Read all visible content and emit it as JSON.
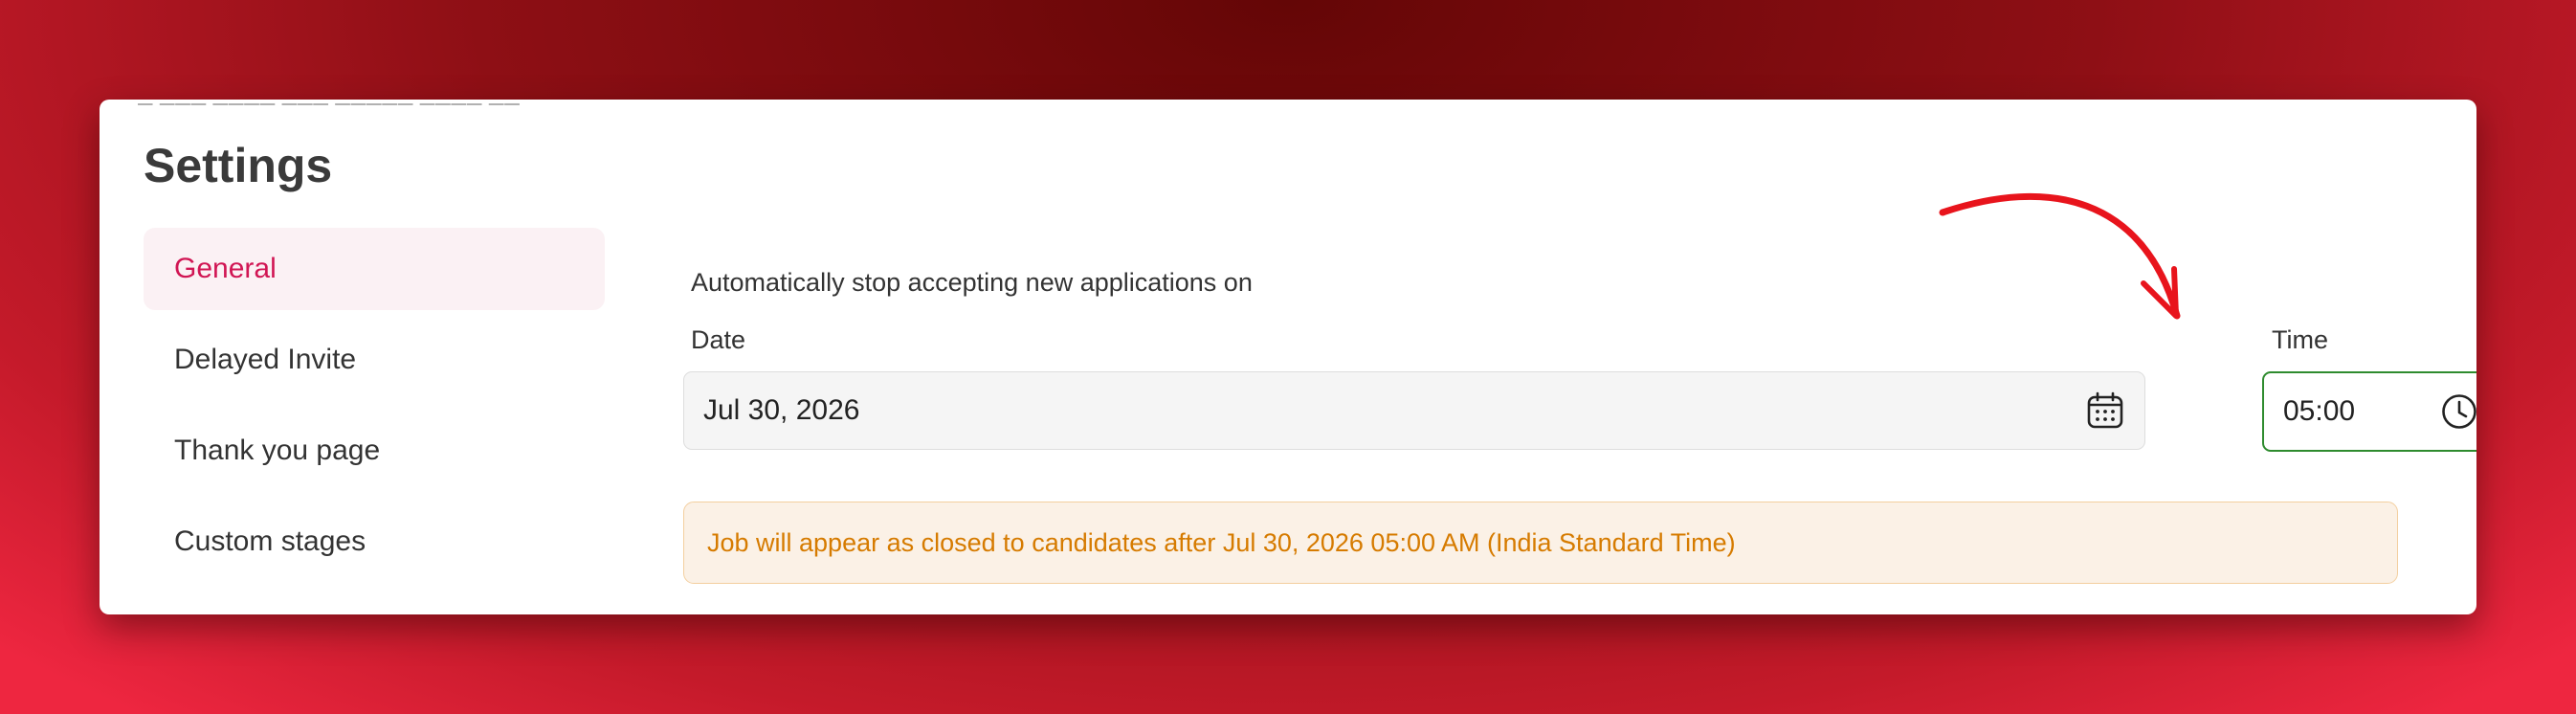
{
  "settings": {
    "title": "Settings"
  },
  "sidebar": {
    "items": [
      {
        "label": "General",
        "active": true
      },
      {
        "label": "Delayed Invite",
        "active": false
      },
      {
        "label": "Thank you page",
        "active": false
      },
      {
        "label": "Custom stages",
        "active": false
      }
    ]
  },
  "form": {
    "stop_label": "Automatically stop accepting new applications on",
    "date_label": "Date",
    "date_value": "Jul 30, 2026",
    "time_label": "Time",
    "time_value": "05:00"
  },
  "notice": {
    "text": "Job will appear as closed to candidates after Jul 30, 2026 05:00 AM (India Standard Time)"
  },
  "icons": {
    "date": "calendar-icon",
    "time": "clock-icon",
    "annotation": "red-arrow-annotation"
  },
  "colors": {
    "accent": "#d11654",
    "active_bg": "#fbf1f4",
    "time_border": "#2e8b2e",
    "notice_text": "#d67b00",
    "notice_bg": "#fbf1e6",
    "arrow": "#e8141c"
  }
}
